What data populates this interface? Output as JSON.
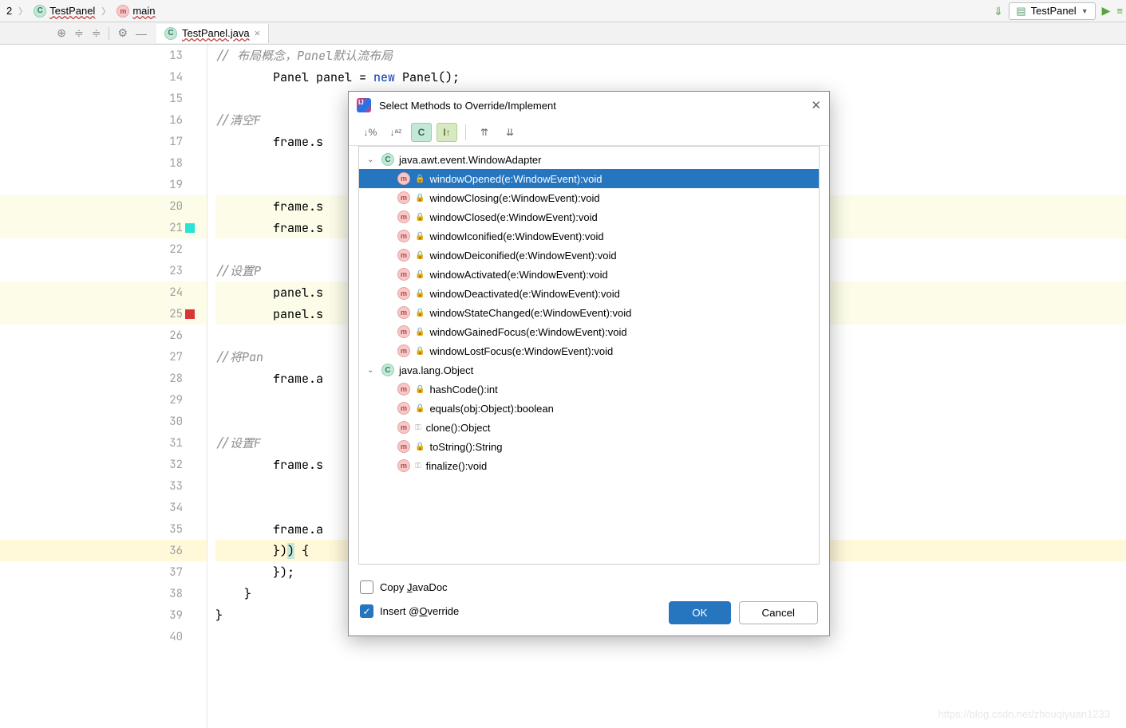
{
  "breadcrumbs": {
    "num": "2",
    "cls": "TestPanel",
    "method": "main"
  },
  "runConfig": "TestPanel",
  "tab": {
    "name": "TestPanel.java"
  },
  "gutter": {
    "start": 13,
    "end": 40
  },
  "code": {
    "indent1": "        ",
    "indent2": "    ",
    "l13": "// 布局概念，Panel默认流布局",
    "l14a": "Panel panel = ",
    "l14b": "new",
    "l14c": " Panel();",
    "l16": "//清空F",
    "l17": "frame.s",
    "l20": "frame.s",
    "l21": "frame.s",
    "l23": "//设置P",
    "l24": "panel.s",
    "l25": "panel.s",
    "l27": "//将Pan",
    "l28": "frame.a",
    "l31": "//设置F",
    "l32": "frame.s",
    "l35": "frame.a",
    "l36a": "})",
    "l36b": " {",
    "l37": "});",
    "l38": "}",
    "l39": "}"
  },
  "dialog": {
    "title": "Select Methods to Override/Implement",
    "groups": [
      {
        "type": "class",
        "label": "java.awt.event.WindowAdapter"
      },
      {
        "type": "method",
        "selected": true,
        "label": "windowOpened(e:WindowEvent):void"
      },
      {
        "type": "method",
        "label": "windowClosing(e:WindowEvent):void"
      },
      {
        "type": "method",
        "label": "windowClosed(e:WindowEvent):void"
      },
      {
        "type": "method",
        "label": "windowIconified(e:WindowEvent):void"
      },
      {
        "type": "method",
        "label": "windowDeiconified(e:WindowEvent):void"
      },
      {
        "type": "method",
        "label": "windowActivated(e:WindowEvent):void"
      },
      {
        "type": "method",
        "label": "windowDeactivated(e:WindowEvent):void"
      },
      {
        "type": "method",
        "label": "windowStateChanged(e:WindowEvent):void"
      },
      {
        "type": "method",
        "label": "windowGainedFocus(e:WindowEvent):void"
      },
      {
        "type": "method",
        "label": "windowLostFocus(e:WindowEvent):void"
      },
      {
        "type": "class",
        "label": "java.lang.Object"
      },
      {
        "type": "method",
        "label": "hashCode():int"
      },
      {
        "type": "method",
        "label": "equals(obj:Object):boolean"
      },
      {
        "type": "method",
        "key": true,
        "label": "clone():Object"
      },
      {
        "type": "method",
        "label": "toString():String"
      },
      {
        "type": "method",
        "key": true,
        "label": "finalize():void"
      }
    ],
    "copyJavadoc": {
      "label_pre": "Copy ",
      "label_u": "J",
      "label_post": "avaDoc",
      "checked": false
    },
    "insertOverride": {
      "label_pre": "Insert @",
      "label_u": "O",
      "label_post": "verride",
      "checked": true
    },
    "ok": "OK",
    "cancel": "Cancel"
  },
  "watermark": "https://blog.csdn.net/zhouqiyuan1233"
}
